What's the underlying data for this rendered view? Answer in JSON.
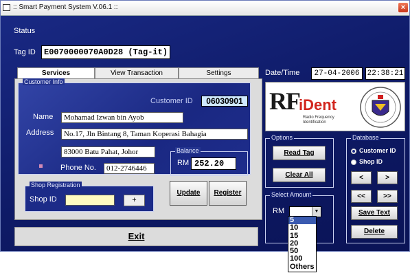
{
  "window": {
    "title": ":: Smart Payment System V.06.1 ::",
    "close": "×"
  },
  "status_label": "Status",
  "tag": {
    "label": "Tag ID",
    "value": "E0070000070A0D28 (Tag-it)"
  },
  "tabs": [
    {
      "label": "Services"
    },
    {
      "label": "View Transaction"
    },
    {
      "label": "Settings"
    }
  ],
  "customer_info": {
    "group_label": "Customer Info",
    "customer_id_label": "Customer ID",
    "customer_id": "06030901",
    "name_label": "Name",
    "name": "Mohamad Izwan bin Ayob",
    "address_label": "Address",
    "address_line1": "No.17, Jln Bintang 8, Taman Koperasi Bahagia",
    "address_line2": "83000 Batu Pahat, Johor",
    "phone_label": "Phone No.",
    "phone": "012-2746446"
  },
  "balance": {
    "group_label": "Balance",
    "currency": "RM",
    "value": "252.20"
  },
  "shop_registration": {
    "group_label": "Shop Registration",
    "shop_id_label": "Shop ID",
    "shop_id": "",
    "add": "+"
  },
  "buttons": {
    "update": "Update",
    "register": "Register",
    "exit": "Exit"
  },
  "datetime": {
    "label": "Date/Time",
    "date": "27-04-2006",
    "time": "22:38:21"
  },
  "logo": {
    "brand_rf": "RF",
    "brand_ident": "iDent",
    "tagline": "Radio Frequency Identification",
    "seal_icon": "university-seal-icon"
  },
  "options": {
    "group_label": "Options",
    "read_tag": "Read Tag",
    "clear_all": "Clear All"
  },
  "database": {
    "group_label": "Database",
    "customer_id_option": "Customer ID",
    "shop_id_option": "Shop ID",
    "prev": "<",
    "next": ">",
    "first": "<<",
    "last": ">>",
    "save_text": "Save Text",
    "delete": "Delete"
  },
  "select_amount": {
    "group_label": "Select Amount",
    "currency": "RM",
    "selected": "",
    "options": [
      "5",
      "10",
      "15",
      "20",
      "50",
      "100",
      "Others"
    ]
  },
  "colors": {
    "window_bg": "#1a2a86",
    "balance_bg": "#ffffff",
    "customer_id_bg": "#cfe9ff",
    "shop_id_bg": "#fffbc0"
  }
}
